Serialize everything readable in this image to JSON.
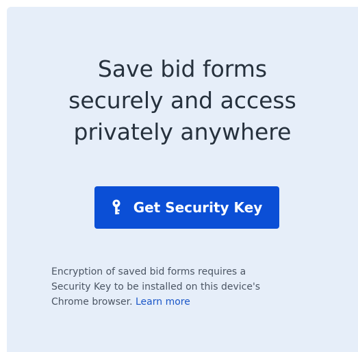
{
  "card": {
    "title_lines": [
      "Save bid forms",
      "securely and access",
      "privately anywhere"
    ],
    "cta": {
      "label": "Get Security Key",
      "icon": "key-icon"
    },
    "note": {
      "line1": "Encryption of saved bid forms requires a",
      "line2": "Security Key to be installed on this device's",
      "line3_prefix": "Chrome browser.",
      "link_label": "Learn more"
    }
  },
  "colors": {
    "card_background": "#e6eef9",
    "button": "#0b4fd6",
    "link": "#1a56c8",
    "title_text": "#26313d"
  }
}
